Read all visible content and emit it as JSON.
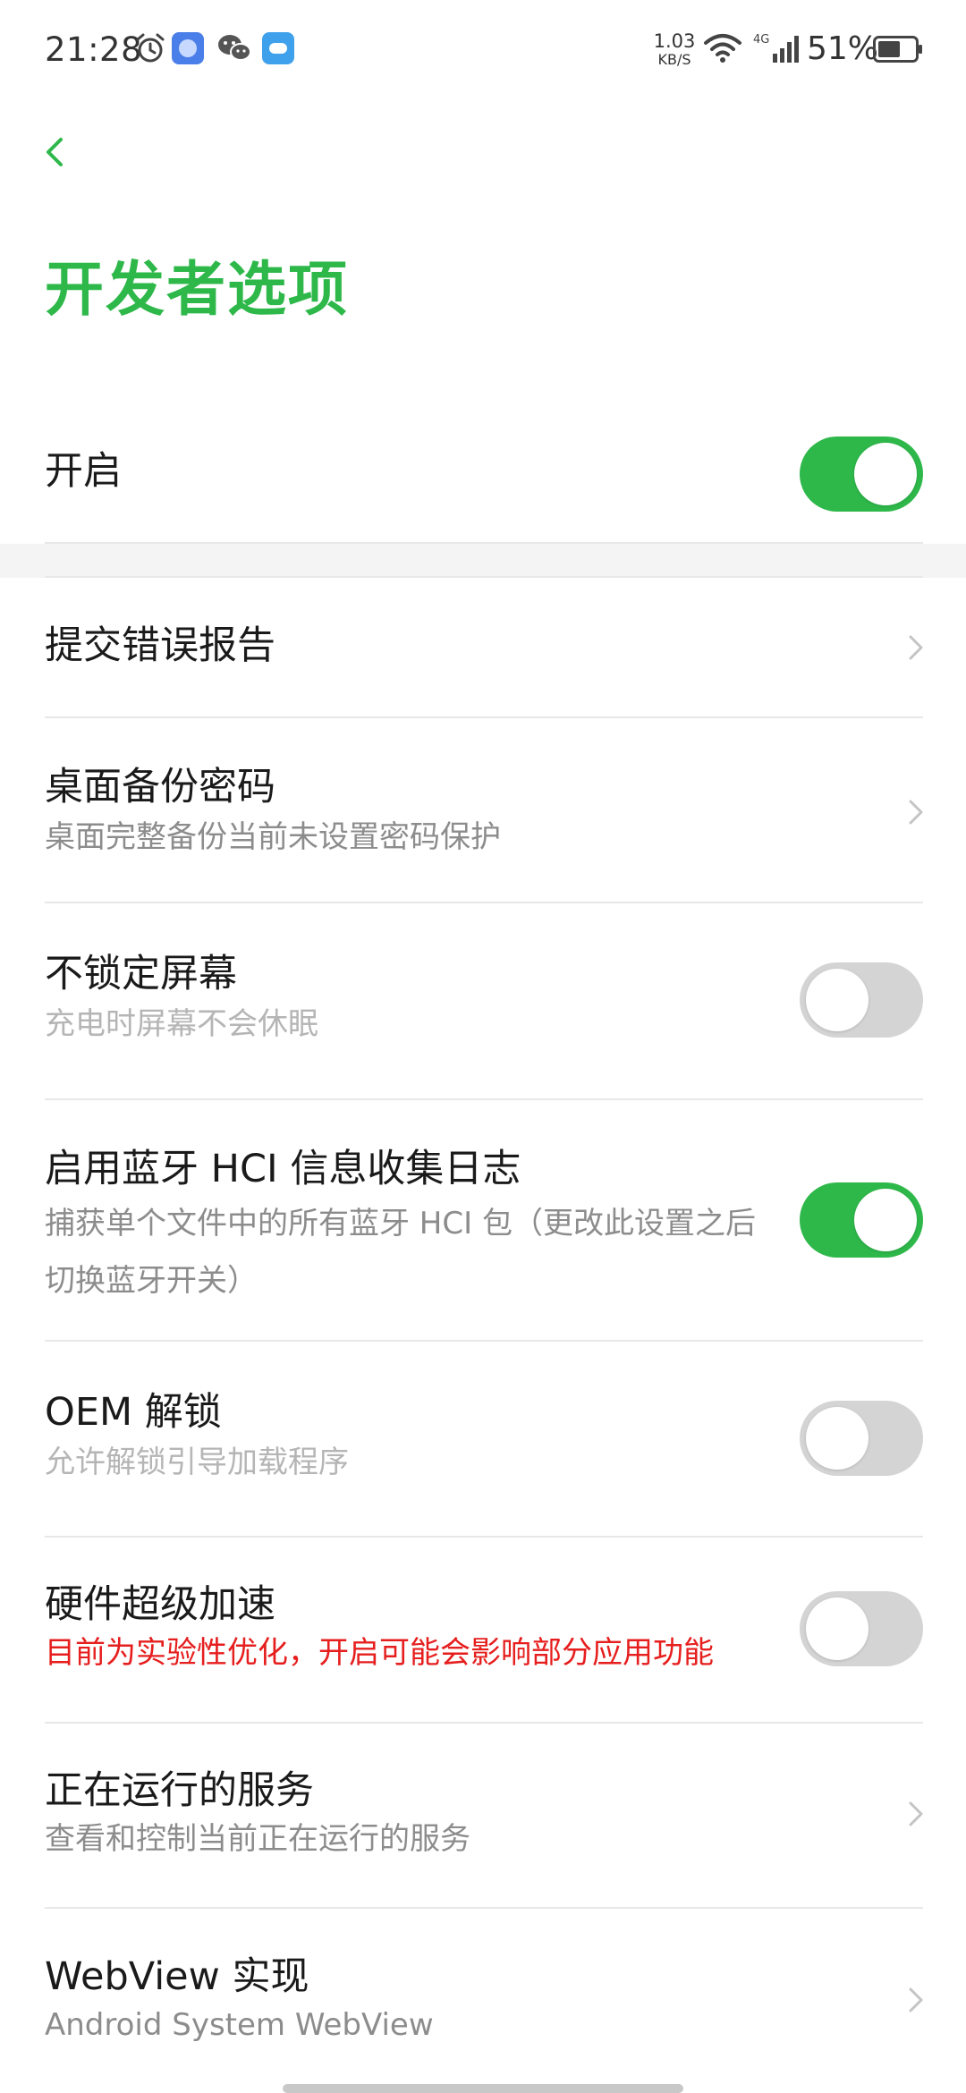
{
  "status_bar": {
    "time": "21:28",
    "net_speed_value": "1.03",
    "net_speed_unit": "KB/S",
    "network_type": "4G",
    "battery_text": "51%",
    "icons": [
      "alarm-icon",
      "app-notification-icon",
      "wechat-icon",
      "weather-icon",
      "wifi-icon",
      "signal-icon",
      "battery-icon"
    ]
  },
  "header": {
    "title": "开发者选项"
  },
  "colors": {
    "accent": "#2eb84a",
    "warning": "#e61e1e",
    "switch_off": "#d4d4d4"
  },
  "settings": {
    "enable": {
      "label": "开启",
      "state": "on"
    },
    "bug_report": {
      "label": "提交错误报告"
    },
    "desktop_backup_password": {
      "label": "桌面备份密码",
      "sub": "桌面完整备份当前未设置密码保护"
    },
    "stay_awake": {
      "label": "不锁定屏幕",
      "sub": "充电时屏幕不会休眠",
      "state": "off"
    },
    "bt_hci_log": {
      "label": "启用蓝牙 HCI 信息收集日志",
      "sub": "捕获单个文件中的所有蓝牙 HCI 包（更改此设置之后切换蓝牙开关）",
      "state": "on"
    },
    "oem_unlock": {
      "label": "OEM 解锁",
      "sub": "允许解锁引导加载程序",
      "state": "off"
    },
    "hw_accel": {
      "label": "硬件超级加速",
      "sub": "目前为实验性优化，开启可能会影响部分应用功能",
      "state": "off"
    },
    "running_services": {
      "label": "正在运行的服务",
      "sub": "查看和控制当前正在运行的服务"
    },
    "webview": {
      "label": "WebView 实现",
      "sub": "Android System WebView"
    }
  }
}
